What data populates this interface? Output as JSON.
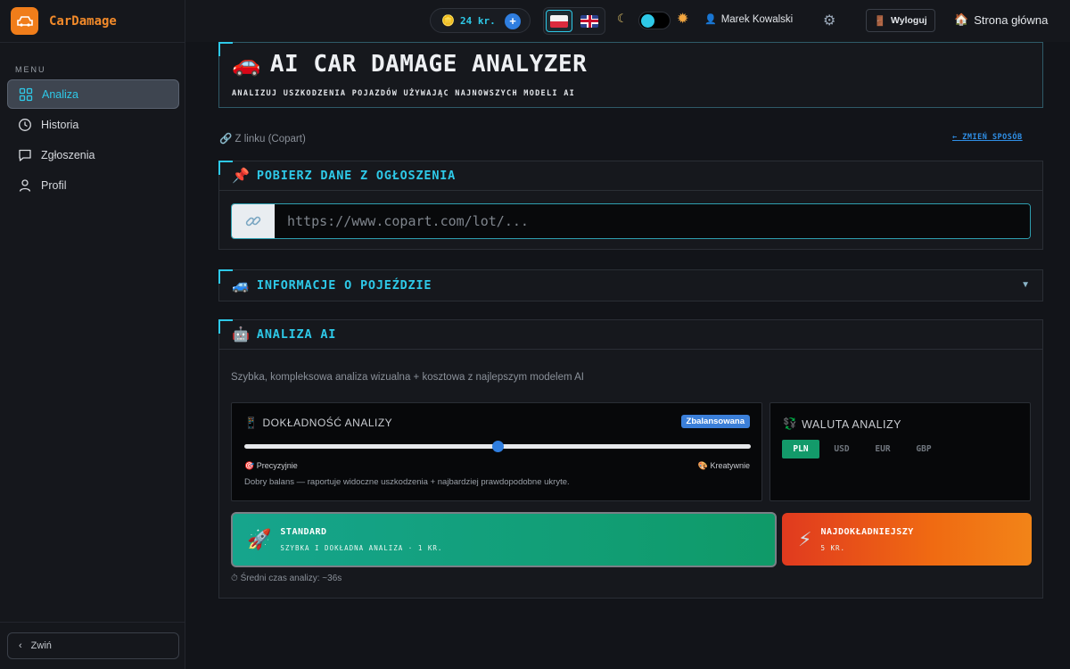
{
  "app": {
    "name": "CarDamage"
  },
  "sidebar": {
    "menu_label": "MENU",
    "items": [
      {
        "label": "Analiza",
        "icon": "grid-icon",
        "active": true
      },
      {
        "label": "Historia",
        "icon": "clock-icon",
        "active": false
      },
      {
        "label": "Zgłoszenia",
        "icon": "chat-icon",
        "active": false
      },
      {
        "label": "Profil",
        "icon": "user-icon",
        "active": false
      }
    ],
    "collapse_label": "Zwiń"
  },
  "topbar": {
    "credits": "24 kr.",
    "user_name": "Marek Kowalski",
    "logout_label": "Wyloguj",
    "home_label": "Strona główna",
    "theme_dark": true
  },
  "header": {
    "title": "AI CAR DAMAGE ANALYZER",
    "subtitle": "ANALIZUJ USZKODZENIA POJAZDÓW UŻYWAJĄC NAJNOWSZYCH MODELI AI"
  },
  "source": {
    "label": "Z linku (Copart)",
    "change_label": "← ZMIEŃ SPOSÓB"
  },
  "fetch": {
    "title": "POBIERZ DANE Z OGŁOSZENIA",
    "placeholder": "https://www.copart.com/lot/..."
  },
  "vehicle": {
    "title": "INFORMACJE O POJEŹDZIE"
  },
  "ai": {
    "title": "ANALIZA AI",
    "description": "Szybka, kompleksowa analiza wizualna + kosztowa z najlepszym modelem AI",
    "accuracy": {
      "title": "DOKŁADNOŚĆ ANALIZY",
      "badge": "Zbalansowana",
      "level": 0.5,
      "left_label": "Precyzyjnie",
      "right_label": "Kreatywnie",
      "description": "Dobry balans — raportuje widoczne uszkodzenia + najbardziej prawdopodobne ukryte."
    },
    "currency": {
      "title": "WALUTA ANALIZY",
      "options": [
        "PLN",
        "USD",
        "EUR",
        "GBP"
      ],
      "selected": "PLN"
    },
    "buttons": {
      "standard_title": "STANDARD",
      "standard_sub": "SZYBKA I DOKŁADNA ANALIZA · 1 KR.",
      "best_title": "NAJDOKŁADNIEJSZY",
      "best_sub": "5 KR."
    },
    "avg_time": "Średni czas analizy: ~36s"
  },
  "colors": {
    "accent": "#2ec9e8",
    "brand": "#f07d1a",
    "success": "#139a6a",
    "danger": "#e03a1f"
  }
}
